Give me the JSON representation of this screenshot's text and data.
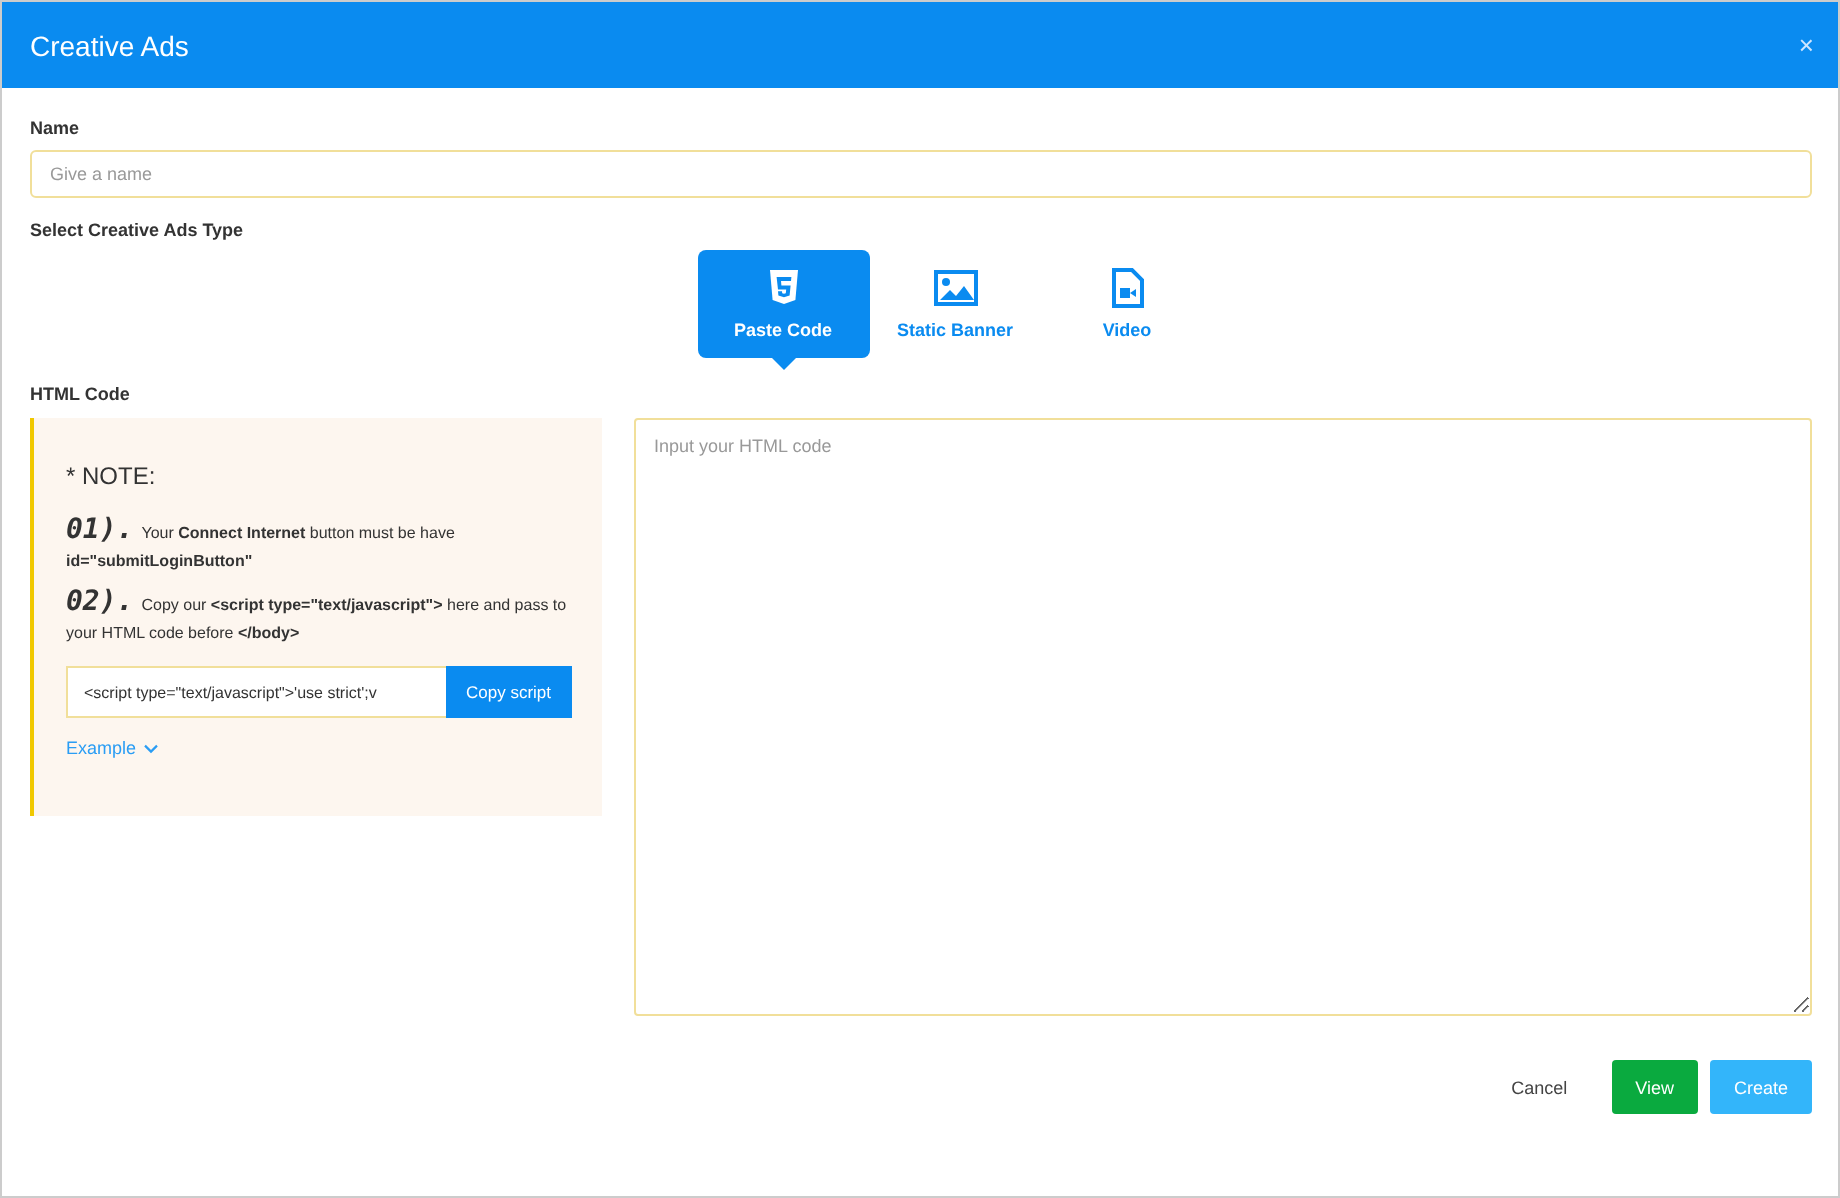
{
  "window": {
    "title": "Creative Ads",
    "close": "×"
  },
  "name_field": {
    "label": "Name",
    "placeholder": "Give a name"
  },
  "type_label": "Select Creative Ads Type",
  "types": [
    {
      "kind": "html5",
      "label": "Paste Code",
      "selected": true
    },
    {
      "kind": "image",
      "label": "Static Banner",
      "selected": false
    },
    {
      "kind": "video",
      "label": "Video",
      "selected": false
    }
  ],
  "html_label": "HTML Code",
  "note": {
    "title": "* NOTE:",
    "steps": [
      {
        "number": "01).",
        "text": "Your **Connect Internet** button must be have **id=\"submitLoginButton\"**"
      },
      {
        "number": "02).",
        "text": "Copy our **<script type=\"text/javascript\">** here and pass to your HTML code before **</body>**"
      }
    ],
    "script_value": "<script type=\"text/javascript\">'use strict';v",
    "copy_button": "Copy script",
    "example_link": "Example"
  },
  "code_field": {
    "placeholder": "Input your HTML code"
  },
  "buttons": [
    {
      "kind": "plain",
      "label": "Cancel"
    },
    {
      "kind": "green",
      "label": "View"
    },
    {
      "kind": "blue",
      "label": "Create"
    }
  ]
}
